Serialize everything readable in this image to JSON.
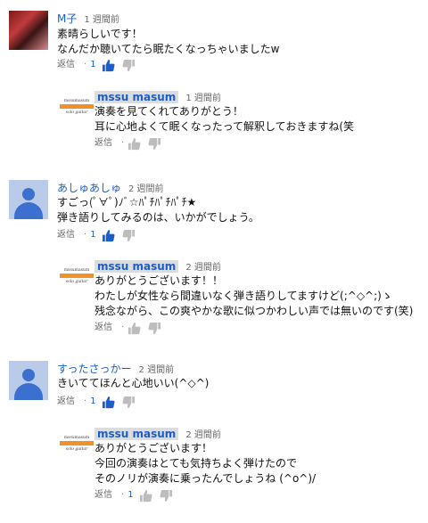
{
  "comments": [
    {
      "author": "M子",
      "time": "1 週間前",
      "lines": [
        "素晴らしいです！",
        "なんだか聴いてたら眠たくなっちゃいましたw"
      ],
      "reply_label": "返信",
      "dot": "·",
      "likes": "1",
      "liked": true
    },
    {
      "author": "mssu masum",
      "time": "1 週間前",
      "lines": [
        "演奏を見てくれてありがとう！",
        "耳に心地よくて眠くなったって解釈しておきますね(笑"
      ],
      "reply_label": "返信",
      "dot": "·",
      "likes": ""
    },
    {
      "author": "あしゅあしゅ",
      "time": "2 週間前",
      "lines": [
        "すごっ(ﾟ∀ﾟ)ﾉﾞ☆ﾊﾟﾁﾊﾟﾁﾊﾟﾁ★",
        "弾き語りしてみるのは、いかがでしょう。"
      ],
      "reply_label": "返信",
      "dot": "·",
      "likes": "1",
      "liked": true
    },
    {
      "author": "mssu masum",
      "time": "2 週間前",
      "lines": [
        "ありがとうございます！！",
        "わたしが女性なら間違いなく弾き語りしてますけど(;^◇^;)ゝ",
        "残念ながら、この爽やかな歌に似つかわしい声では無いのです(笑)"
      ],
      "reply_label": "返信",
      "dot": "·",
      "likes": ""
    },
    {
      "author": "すったさっかー",
      "time": "2 週間前",
      "lines": [
        "きいててほんと心地いい(^◇^)"
      ],
      "reply_label": "返信",
      "dot": "·",
      "likes": "1",
      "liked": true
    },
    {
      "author": "mssu masum",
      "time": "2 週間前",
      "lines": [
        "ありがとうございます！",
        "今回の演奏はとても気持ちよく弾けたので",
        "そのノリが演奏に乗ったんでしょうね (^o^)/"
      ],
      "reply_label": "返信",
      "dot": "·",
      "likes": "1",
      "liked": false
    }
  ],
  "logo": {
    "top_text": "mssumasum",
    "sub_text": "solo guitar"
  },
  "colors": {
    "author": "#1a5fc9",
    "like_active": "#1a5fc9",
    "icon_gray": "#bdbdbd"
  },
  "icons": {
    "like": "thumbs-up-icon",
    "dislike": "thumbs-down-icon"
  }
}
